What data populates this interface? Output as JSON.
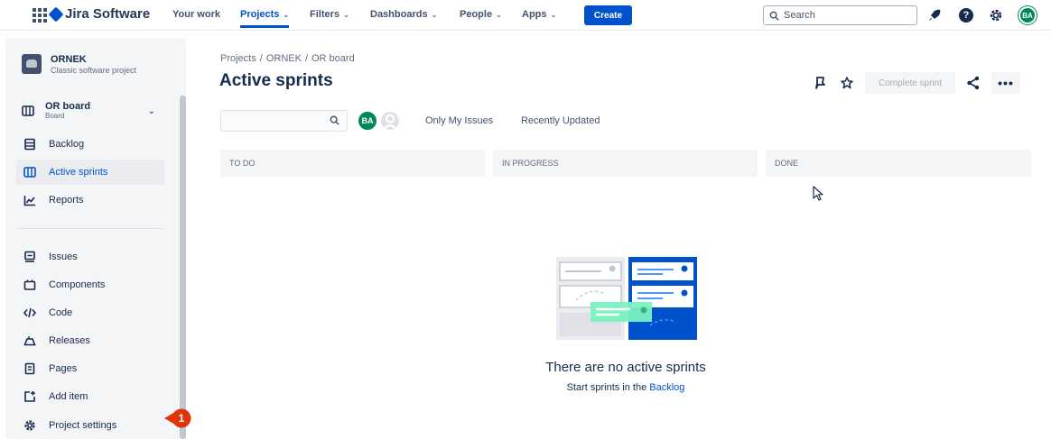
{
  "topnav": {
    "product": "Jira Software",
    "items": [
      {
        "label": "Your work",
        "active": false,
        "chevron": false
      },
      {
        "label": "Projects",
        "active": true,
        "chevron": true
      },
      {
        "label": "Filters",
        "active": false,
        "chevron": true
      },
      {
        "label": "Dashboards",
        "active": false,
        "chevron": true
      },
      {
        "label": "People",
        "active": false,
        "chevron": true
      },
      {
        "label": "Apps",
        "active": false,
        "chevron": true
      }
    ],
    "create_label": "Create",
    "search_placeholder": "Search",
    "user_initials": "BA"
  },
  "sidebar": {
    "project_name": "ORNEK",
    "project_type": "Classic software project",
    "board_name": "OR board",
    "board_type": "Board",
    "items": [
      {
        "label": "Backlog",
        "icon": "backlog-icon",
        "selected": false
      },
      {
        "label": "Active sprints",
        "icon": "board-icon",
        "selected": true
      },
      {
        "label": "Reports",
        "icon": "reports-icon",
        "selected": false
      },
      {
        "label": "Issues",
        "icon": "issues-icon",
        "selected": false
      },
      {
        "label": "Components",
        "icon": "components-icon",
        "selected": false
      },
      {
        "label": "Code",
        "icon": "code-icon",
        "selected": false
      },
      {
        "label": "Releases",
        "icon": "releases-icon",
        "selected": false
      },
      {
        "label": "Pages",
        "icon": "pages-icon",
        "selected": false
      },
      {
        "label": "Add item",
        "icon": "add-item-icon",
        "selected": false
      },
      {
        "label": "Project settings",
        "icon": "gear-icon",
        "selected": false
      }
    ],
    "annotation_badge": "1"
  },
  "main": {
    "breadcrumb": [
      "Projects",
      "/",
      "ORNEK",
      "/",
      "OR board"
    ],
    "title": "Active sprints",
    "complete_sprint_label": "Complete sprint",
    "more_label": "•••",
    "avatar_initials": "BA",
    "quick_filters": [
      "Only My Issues",
      "Recently Updated"
    ],
    "columns": [
      "TO DO",
      "IN PROGRESS",
      "DONE"
    ],
    "empty_title": "There are no active sprints",
    "empty_sub_prefix": "Start sprints in the",
    "empty_sub_link": "Backlog"
  },
  "colors": {
    "brand_blue": "#0052cc",
    "avatar_green": "#00875a",
    "badge_red": "#de350b"
  }
}
